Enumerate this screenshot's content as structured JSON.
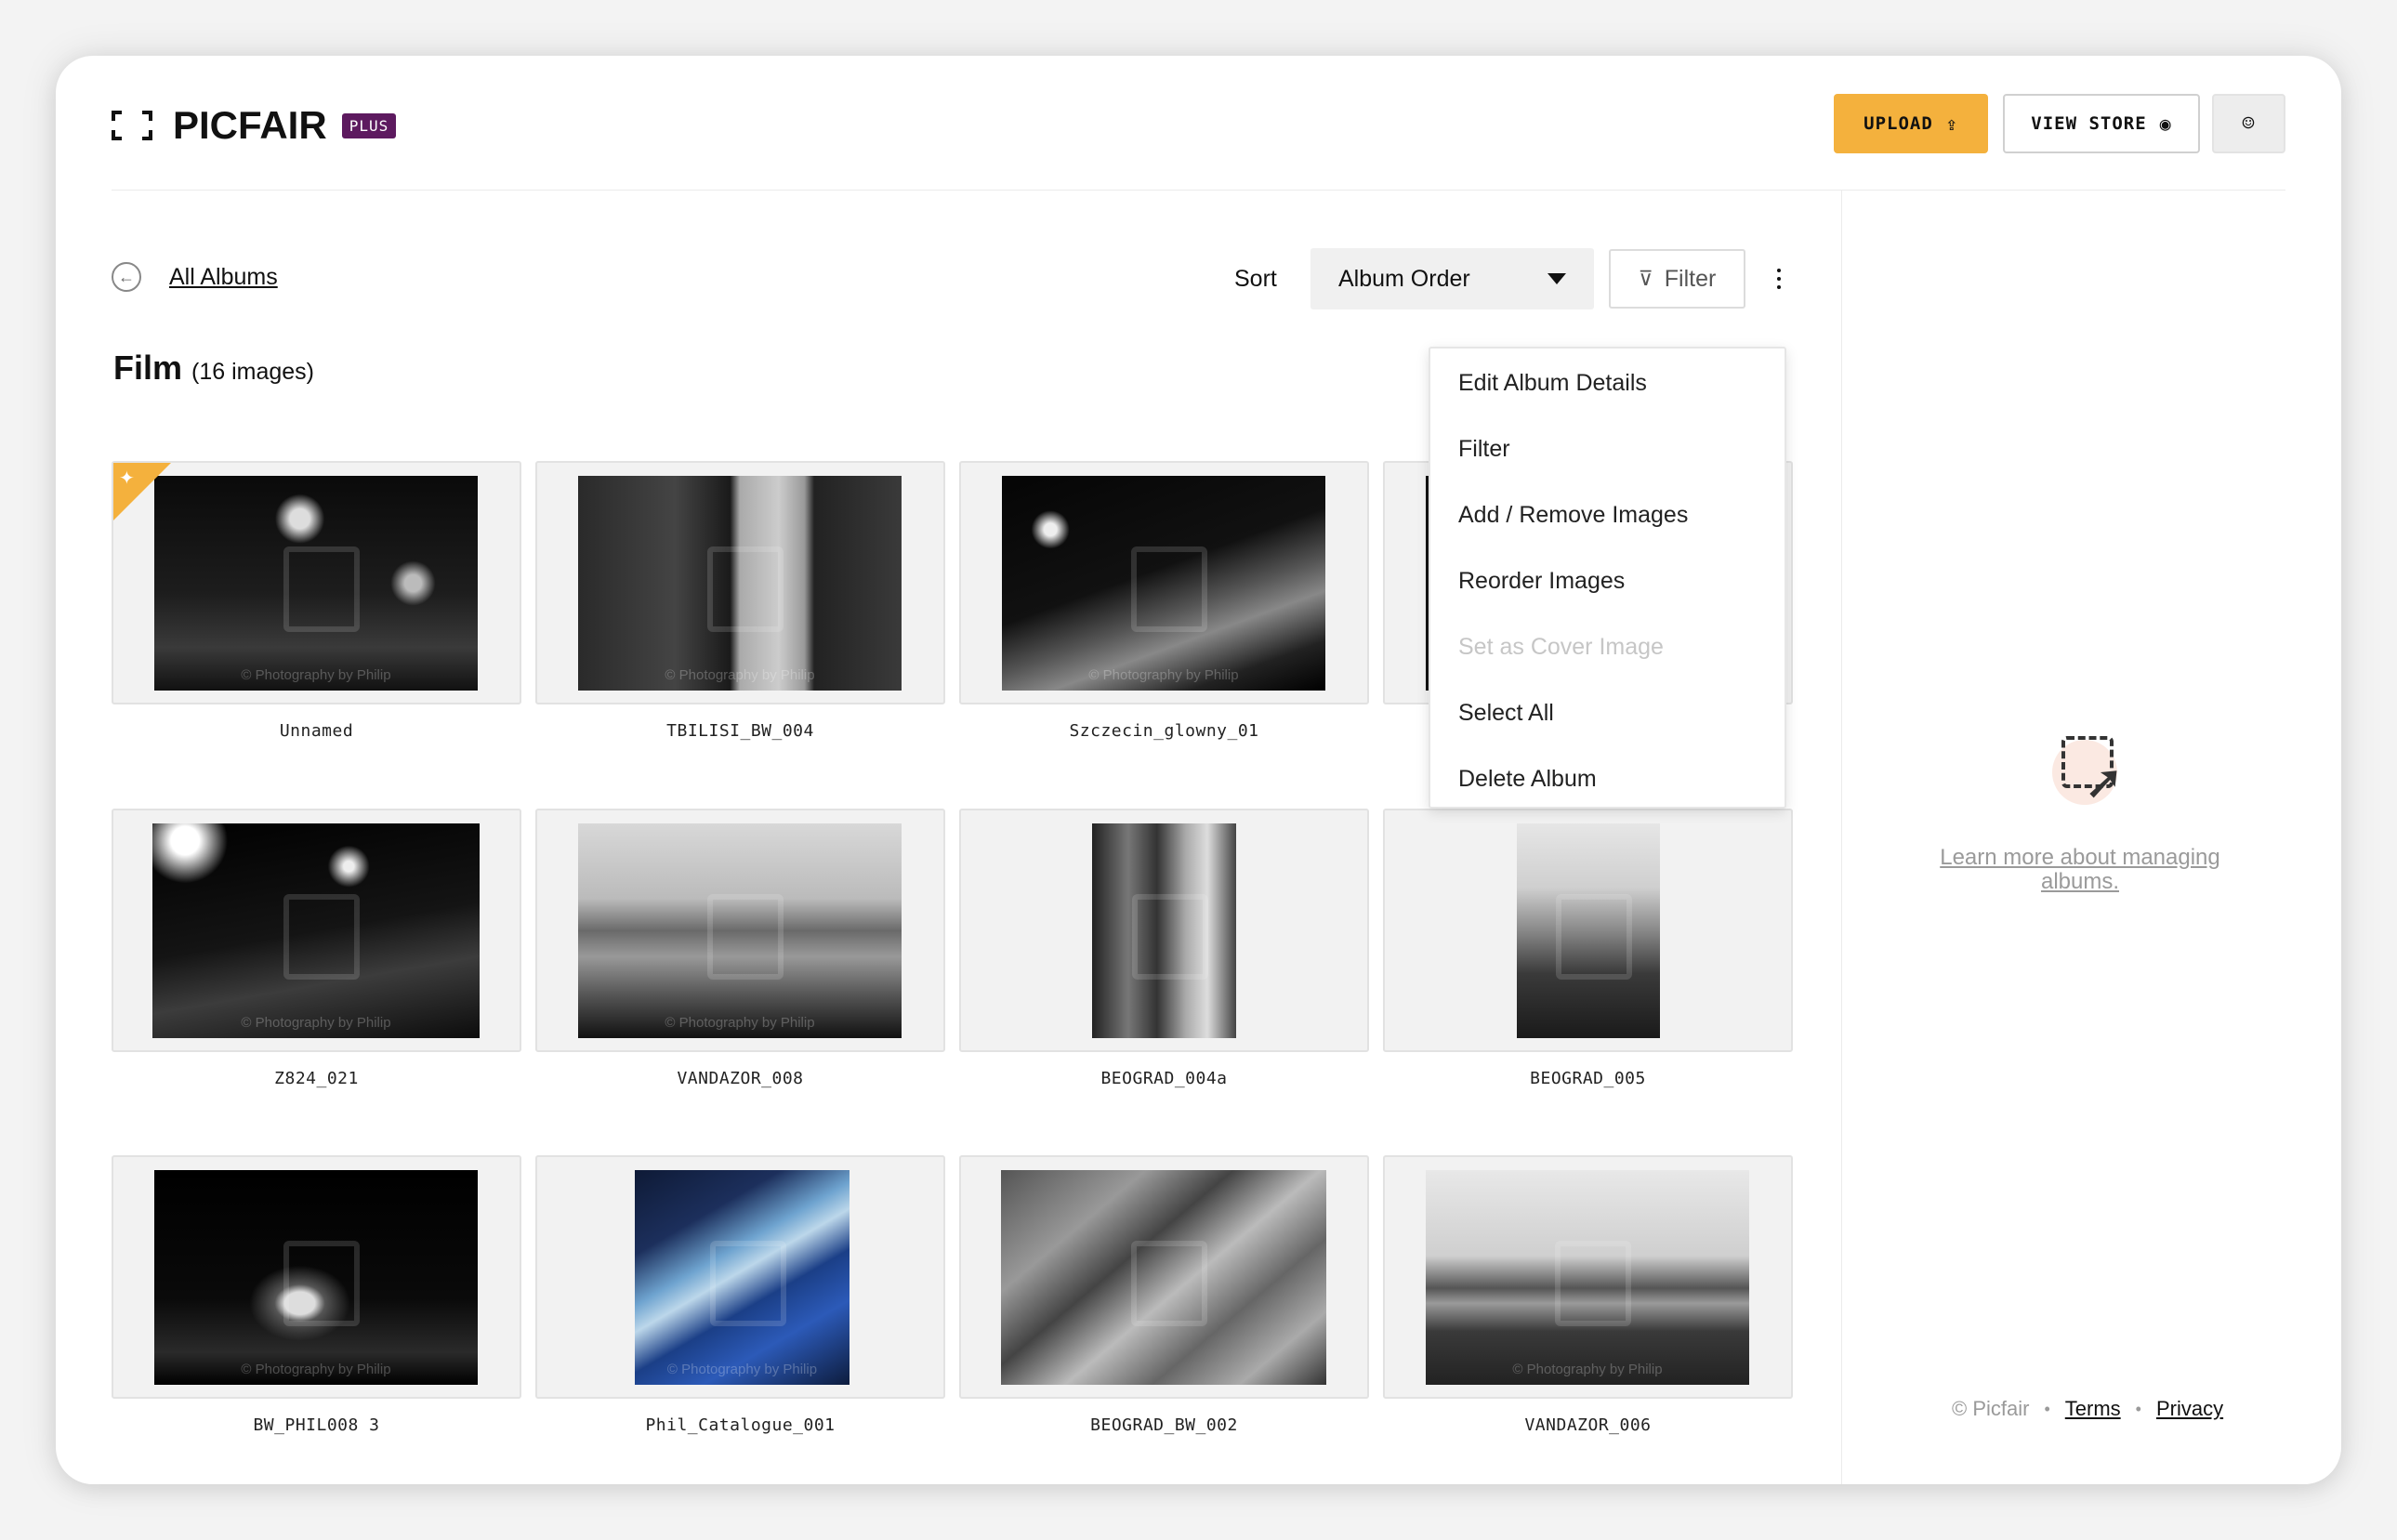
{
  "header": {
    "brand": "PICFAIR",
    "brand_badge": "PLUS",
    "upload_label": "UPLOAD",
    "view_store_label": "VIEW STORE"
  },
  "toolbar": {
    "back_label": "All Albums",
    "sort_label": "Sort",
    "sort_value": "Album Order",
    "filter_label": "Filter"
  },
  "album": {
    "name": "Film",
    "count": "(16 images)"
  },
  "menu": {
    "items": [
      {
        "label": "Edit Album Details",
        "enabled": true
      },
      {
        "label": "Filter",
        "enabled": true
      },
      {
        "label": "Add / Remove Images",
        "enabled": true
      },
      {
        "label": "Reorder Images",
        "enabled": true
      },
      {
        "label": "Set as Cover Image",
        "enabled": false
      },
      {
        "label": "Select All",
        "enabled": true
      },
      {
        "label": "Delete Album",
        "enabled": true
      }
    ]
  },
  "images": [
    {
      "caption": "Unnamed",
      "watermark": "© Photography by Philip",
      "is_cover": true
    },
    {
      "caption": "TBILISI_BW_004",
      "watermark": "© Photography by Philip"
    },
    {
      "caption": "Szczecin_glowny_01",
      "watermark": "© Photography by Philip"
    },
    {
      "caption": "",
      "watermark": ""
    },
    {
      "caption": "Z824_021",
      "watermark": "© Photography by Philip"
    },
    {
      "caption": "VANDAZOR_008",
      "watermark": "© Photography by Philip"
    },
    {
      "caption": "BEOGRAD_004a",
      "watermark": ""
    },
    {
      "caption": "BEOGRAD_005",
      "watermark": ""
    },
    {
      "caption": "BW_PHIL008 3",
      "watermark": "© Photography by Philip"
    },
    {
      "caption": "Phil_Catalogue_001",
      "watermark": "© Photography by Philip"
    },
    {
      "caption": "BEOGRAD_BW_002",
      "watermark": ""
    },
    {
      "caption": "VANDAZOR_006",
      "watermark": "© Photography by Philip"
    }
  ],
  "side_panel": {
    "learn_more": "Learn more about managing albums."
  },
  "footer": {
    "copyright": "© Picfair",
    "terms": "Terms",
    "privacy": "Privacy"
  },
  "colors": {
    "accent": "#f4b13d",
    "badge": "#5d1a5f"
  }
}
